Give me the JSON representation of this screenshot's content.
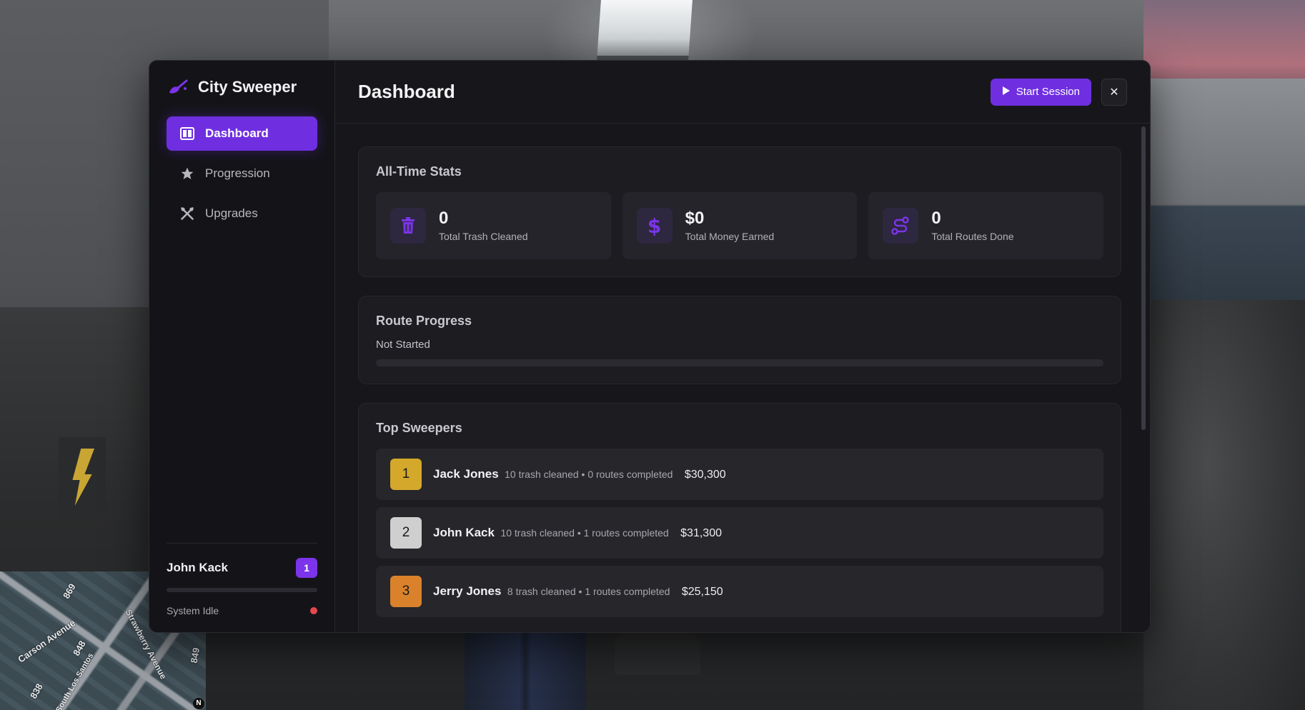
{
  "app": {
    "brand_name": "City Sweeper",
    "accent_color": "#6f2fe0"
  },
  "sidebar": {
    "items": [
      {
        "label": "Dashboard",
        "icon": "dashboard-icon",
        "active": true
      },
      {
        "label": "Progression",
        "icon": "star-icon",
        "active": false
      },
      {
        "label": "Upgrades",
        "icon": "wrench-screwdriver-icon",
        "active": false
      }
    ],
    "user": {
      "name": "John Kack",
      "level": "1",
      "xp_progress": 0
    },
    "status": {
      "text": "System Idle",
      "dot_color": "#e5484d"
    }
  },
  "header": {
    "title": "Dashboard",
    "start_button_label": "Start Session",
    "close_label": "✕"
  },
  "stats": {
    "title": "All-Time Stats",
    "items": [
      {
        "value": "0",
        "label": "Total Trash Cleaned",
        "icon": "trash-icon"
      },
      {
        "value": "$0",
        "label": "Total Money Earned",
        "icon": "dollar-icon"
      },
      {
        "value": "0",
        "label": "Total Routes Done",
        "icon": "route-icon"
      }
    ]
  },
  "route_progress": {
    "title": "Route Progress",
    "status": "Not Started",
    "progress": 0
  },
  "leaderboard": {
    "title": "Top Sweepers",
    "rows": [
      {
        "rank": "1",
        "name": "Jack Jones",
        "meta": "10 trash cleaned • 0 routes completed",
        "money": "$30,300",
        "rank_color": "#d4a82a"
      },
      {
        "rank": "2",
        "name": "John Kack",
        "meta": "10 trash cleaned • 1 routes completed",
        "money": "$31,300",
        "rank_color": "#cfcfcf"
      },
      {
        "rank": "3",
        "name": "Jerry Jones",
        "meta": "8 trash cleaned • 1 routes completed",
        "money": "$25,150",
        "rank_color": "#d9822b"
      }
    ]
  },
  "minimap": {
    "labels": [
      "Carson Avenue",
      "South Los Santos",
      "Strawberry Avenue",
      "849",
      "848",
      "838",
      "869",
      "N"
    ]
  }
}
